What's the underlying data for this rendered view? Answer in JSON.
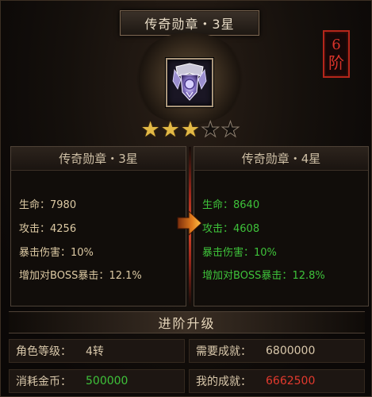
{
  "title": "传奇勋章・3星",
  "stage_badge": {
    "number": "6",
    "unit": "阶"
  },
  "stars": {
    "filled": 3,
    "total": 6
  },
  "current": {
    "title": "传奇勋章・3星",
    "stats": [
      {
        "label": "生命：",
        "value": "7980"
      },
      {
        "label": "攻击：",
        "value": "4256"
      },
      {
        "label": "暴击伤害：",
        "value": "10%"
      },
      {
        "label": "增加对BOSS暴击：",
        "value": "12.1%"
      }
    ]
  },
  "next": {
    "title": "传奇勋章・4星",
    "stats": [
      {
        "label": "生命：",
        "value": "8640"
      },
      {
        "label": "攻击：",
        "value": "4608"
      },
      {
        "label": "暴击伤害：",
        "value": "10%"
      },
      {
        "label": "增加对BOSS暴击：",
        "value": "12.8%"
      }
    ]
  },
  "upgrade": {
    "section_title": "进阶升级",
    "role_level_label": "角色等级：",
    "role_level_value": "4转",
    "required_achievement_label": "需要成就：",
    "required_achievement_value": "6800000",
    "gold_cost_label": "消耗金币：",
    "gold_cost_value": "500000",
    "my_achievement_label": "我的成就：",
    "my_achievement_value": "6662500"
  },
  "colors": {
    "gold_star": "#e2b946",
    "stat_green": "#3ec23a",
    "stat_red": "#e33a2e",
    "badge_red": "#b5261b"
  },
  "icons": [
    "medal-icon",
    "star-icon",
    "arrow-right-icon"
  ]
}
